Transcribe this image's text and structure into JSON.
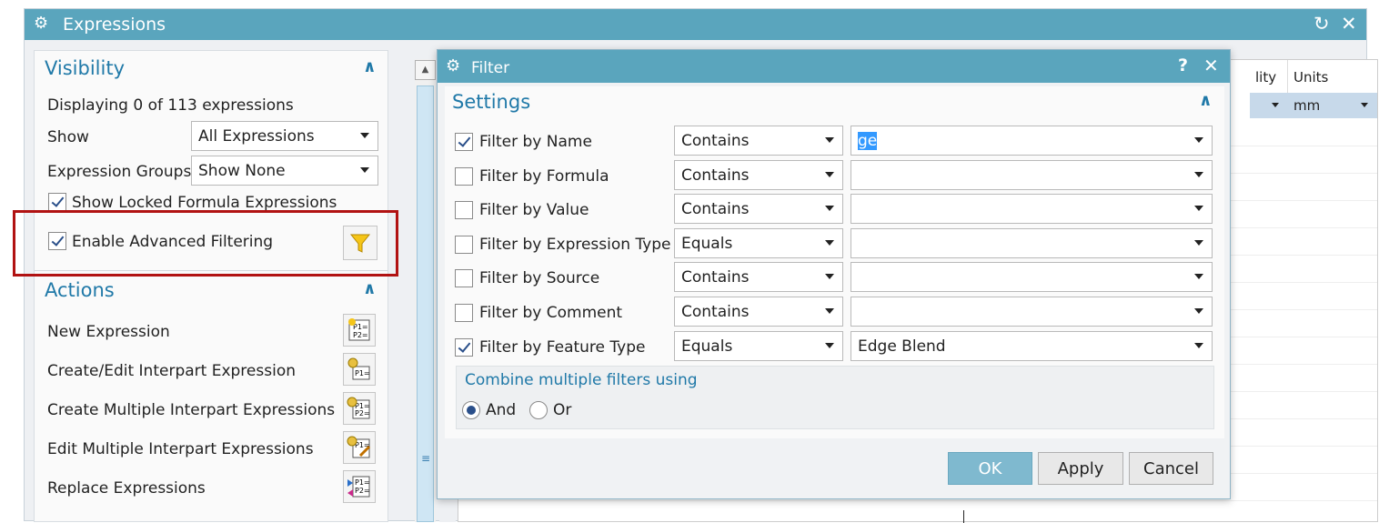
{
  "window": {
    "title": "Expressions"
  },
  "visibility": {
    "title": "Visibility",
    "displaying": "Displaying 0 of 113 expressions",
    "show_label": "Show",
    "show_value": "All Expressions",
    "groups_label": "Expression Groups",
    "groups_value": "Show None",
    "locked_label": "Show Locked Formula Expressions",
    "advanced_label": "Enable Advanced Filtering"
  },
  "actions": {
    "title": "Actions",
    "items": [
      {
        "label": "New Expression",
        "icon": "new-expression-icon"
      },
      {
        "label": "Create/Edit Interpart Expression",
        "icon": "interpart-expression-icon"
      },
      {
        "label": "Create Multiple Interpart Expressions",
        "icon": "multiple-interpart-icon"
      },
      {
        "label": "Edit Multiple Interpart Expressions",
        "icon": "edit-multiple-interpart-icon"
      },
      {
        "label": "Replace Expressions",
        "icon": "replace-expressions-icon"
      }
    ]
  },
  "table": {
    "col_partial": "lity",
    "col_units": "Units",
    "units_value": "mm"
  },
  "filter_dialog": {
    "title": "Filter",
    "help": "?",
    "section_title": "Settings",
    "rows": [
      {
        "label": "Filter by Name",
        "checked": true,
        "operator": "Contains",
        "value": "ge"
      },
      {
        "label": "Filter by Formula",
        "checked": false,
        "operator": "Contains",
        "value": ""
      },
      {
        "label": "Filter by Value",
        "checked": false,
        "operator": "Contains",
        "value": ""
      },
      {
        "label": "Filter by Expression Type",
        "checked": false,
        "operator": "Equals",
        "value": ""
      },
      {
        "label": "Filter by Source",
        "checked": false,
        "operator": "Contains",
        "value": ""
      },
      {
        "label": "Filter by Comment",
        "checked": false,
        "operator": "Contains",
        "value": ""
      },
      {
        "label": "Filter by Feature Type",
        "checked": true,
        "operator": "Equals",
        "value": "Edge Blend"
      }
    ],
    "combine": {
      "title": "Combine multiple filters using",
      "and": "And",
      "or": "Or",
      "selected": "And"
    },
    "buttons": {
      "ok": "OK",
      "apply": "Apply",
      "cancel": "Cancel"
    }
  },
  "colors": {
    "title_bar": "#5aa5bd",
    "accent_text": "#2079a8",
    "highlight_border": "#b11212",
    "ok_button": "#7fb9cf"
  }
}
